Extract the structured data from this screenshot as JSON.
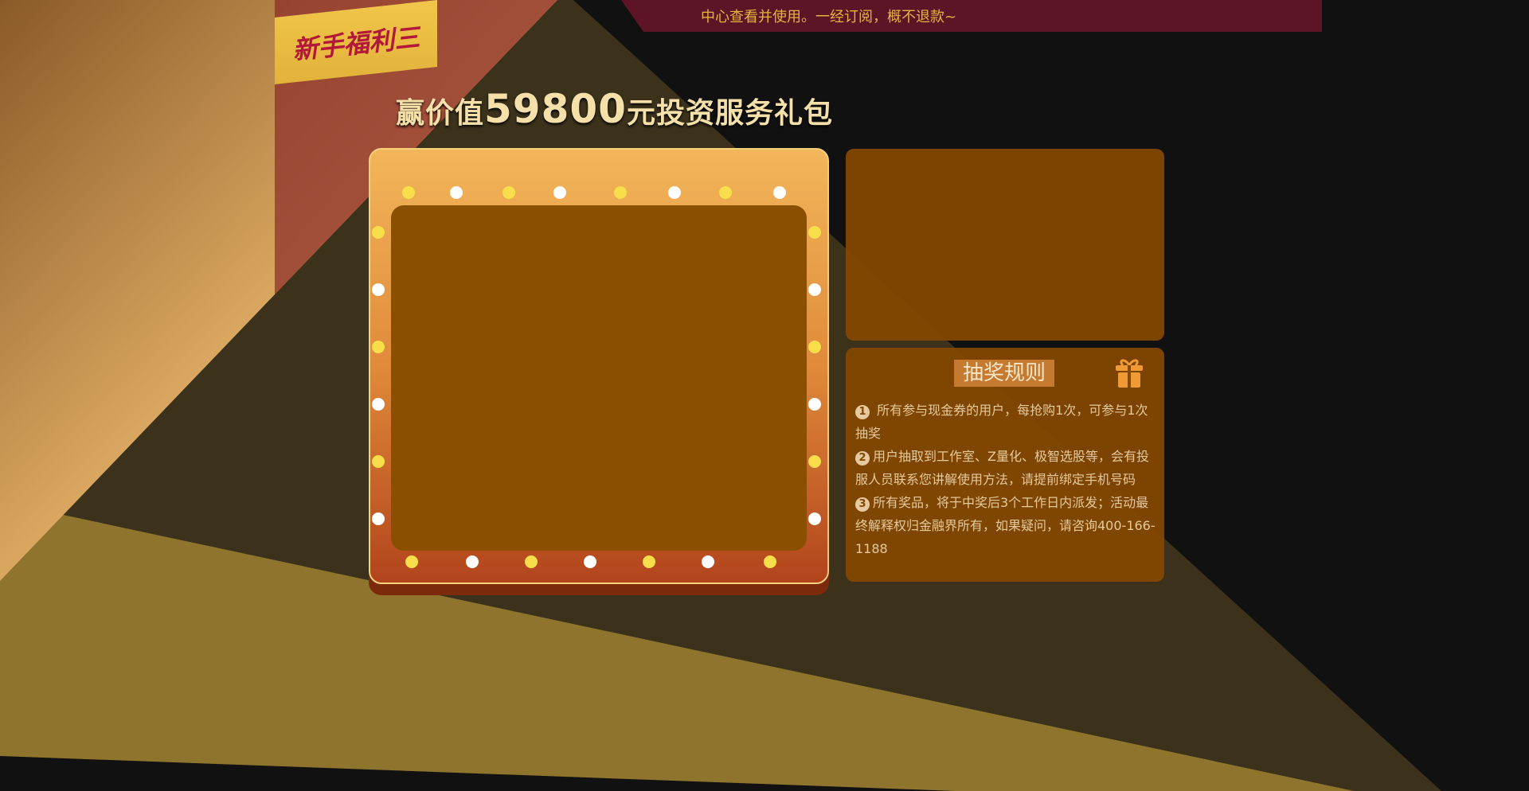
{
  "banner": {
    "text": "中心查看并使用。一经订阅，概不退款~"
  },
  "ribbon": {
    "label": "新手福利三"
  },
  "title": {
    "prefix": "赢价值",
    "amount": "59800",
    "suffix": "元投资服务礼包"
  },
  "rules": {
    "title": "抽奖规则",
    "icon": "gift-icon",
    "items": [
      {
        "num": "1",
        "text": " 所有参与现金券的用户，每抢购1次，可参与1次抽奖"
      },
      {
        "num": "2",
        "text": "用户抽取到工作室、Z量化、极智选股等，会有投服人员联系您讲解使用方法，请提前绑定手机号码"
      },
      {
        "num": "3",
        "text": "所有奖品，将于中奖后3个工作日内派发；活动最终解释权归金融界所有，如果疑问，请咨询400-166-1188"
      }
    ]
  },
  "colors": {
    "background": "#111111",
    "beam": "#8f742e",
    "panel": "#854800",
    "ribbon": "#e8b83e",
    "ribbon_text": "#b3183a"
  }
}
